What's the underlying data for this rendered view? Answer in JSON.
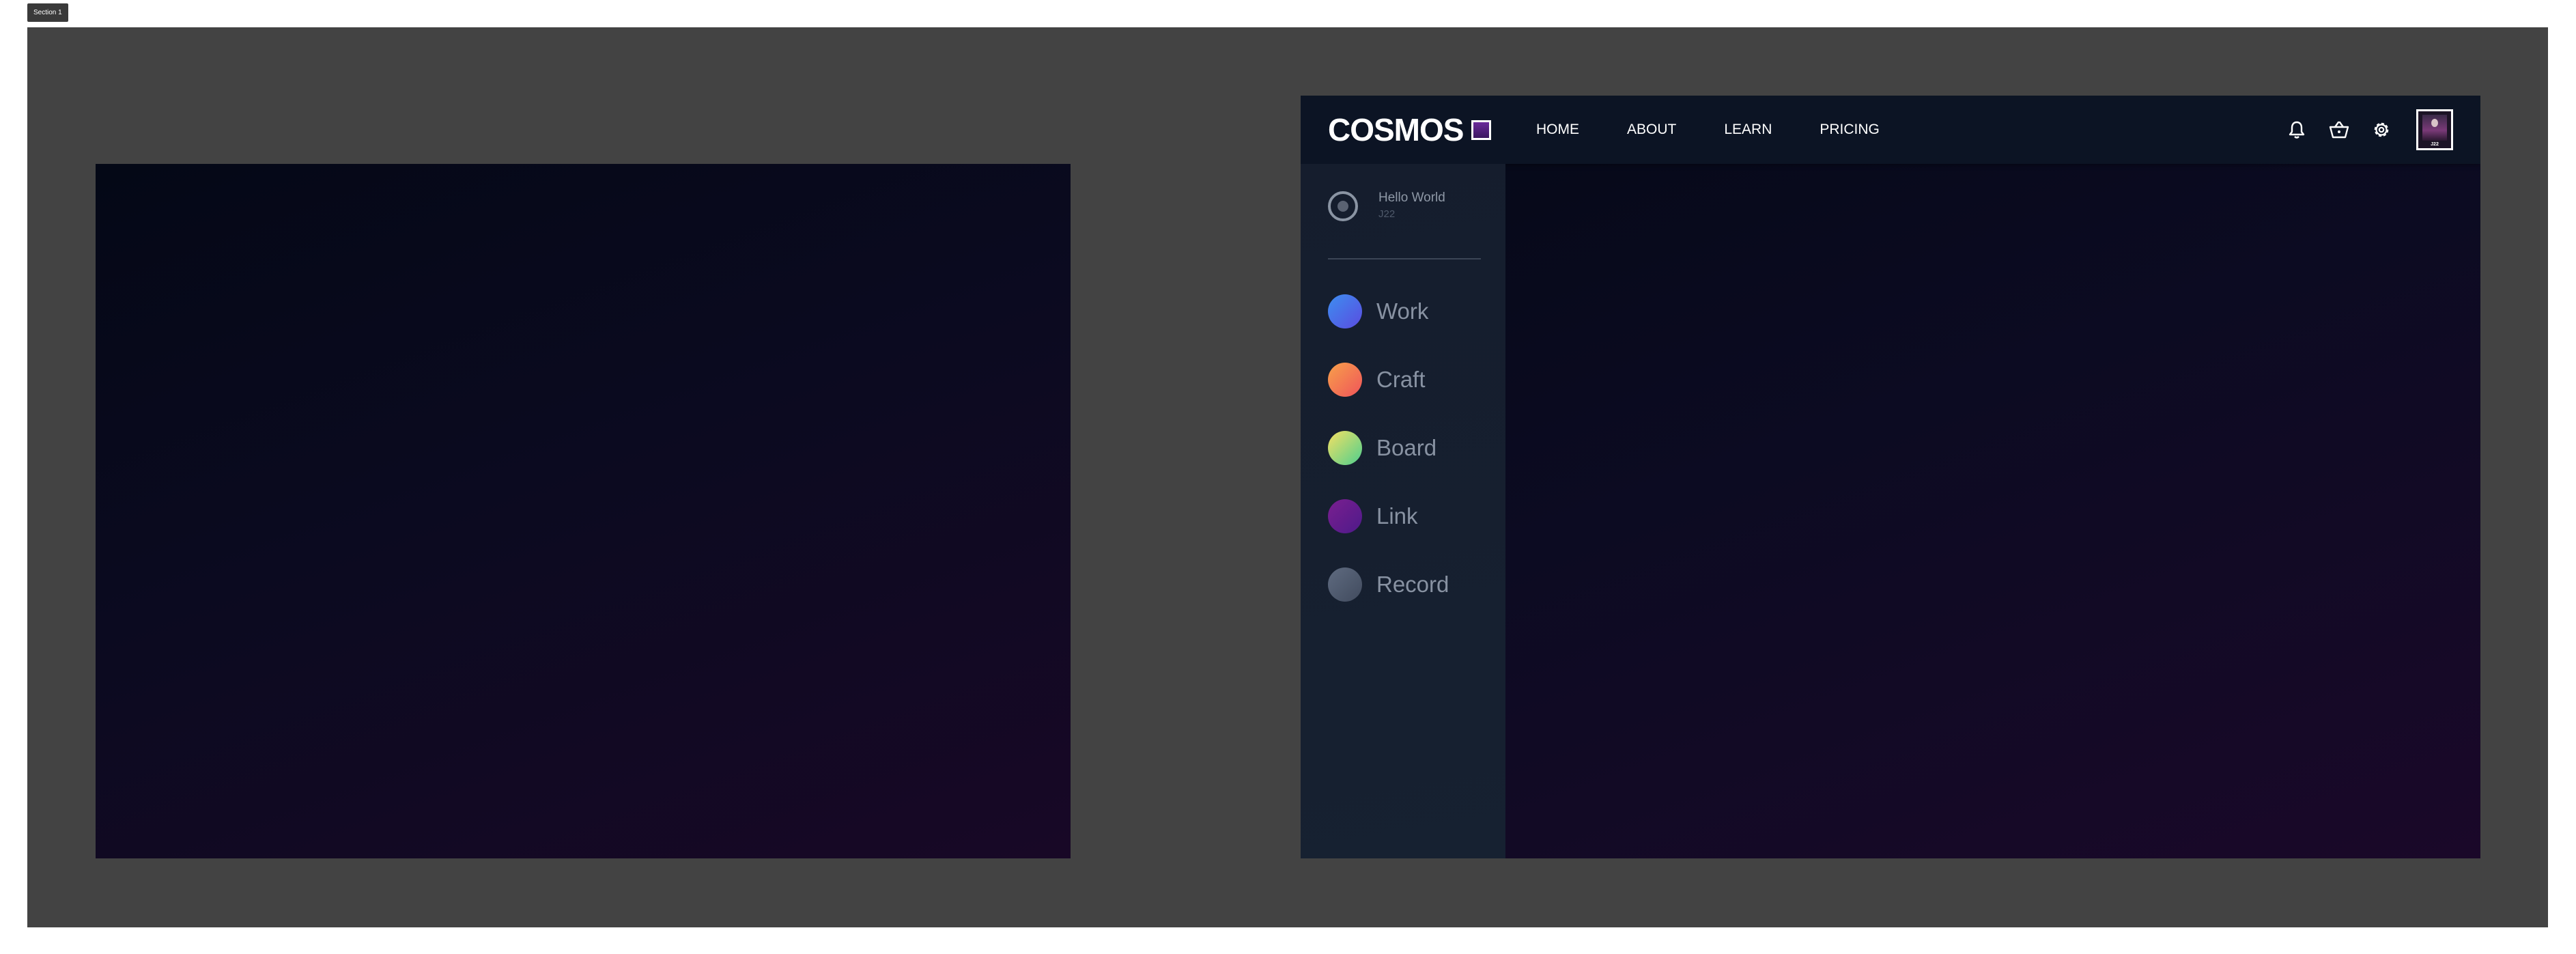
{
  "section_tag": "Section 1",
  "app": {
    "logo": "COSMOS",
    "nav": [
      "HOME",
      "ABOUT",
      "LEARN",
      "PRICING"
    ],
    "icons": [
      "bell-icon",
      "basket-icon",
      "gear-icon"
    ],
    "avatar_label": "J22"
  },
  "sidebar": {
    "profile": {
      "name": "Hello World",
      "sub": "J22"
    },
    "items": [
      {
        "label": "Work",
        "colors": [
          "#3d8ef0",
          "#5a4ce0"
        ]
      },
      {
        "label": "Craft",
        "colors": [
          "#f7a14a",
          "#f0545a"
        ]
      },
      {
        "label": "Board",
        "colors": [
          "#f5e063",
          "#4ecf8e"
        ]
      },
      {
        "label": "Link",
        "colors": [
          "#7a1f8f",
          "#4e1a8a"
        ]
      },
      {
        "label": "Record",
        "colors": [
          "#5f6b80",
          "#414b5e"
        ]
      }
    ]
  },
  "colors": {
    "canvas": "#434343",
    "topbar": "#0c1424",
    "sidebar": "#151d2d",
    "gradient_start": "#040816",
    "gradient_end": "#1a0829"
  }
}
